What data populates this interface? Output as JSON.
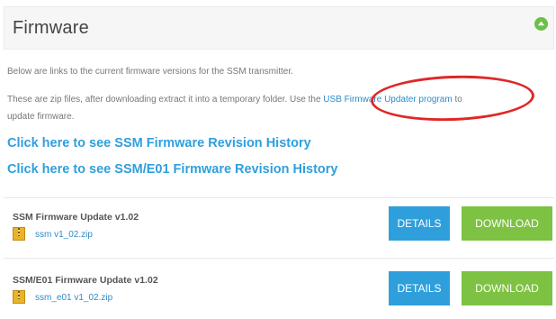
{
  "header": {
    "title": "Firmware",
    "toggle_icon": "collapse-icon"
  },
  "intro": {
    "line1": "Below are links to the current firmware versions for the SSM transmitter.",
    "line2_pre": "These are zip files, after downloading extract it into a temporary folder. Use the ",
    "updater_link": "USB Firmware Updater program",
    "line2_post": " to",
    "line3": "update firmware."
  },
  "history_links": [
    "Click here to see SSM Firmware Revision History",
    "Click here to see SSM/E01 Firmware Revision History"
  ],
  "firmware": [
    {
      "title": "SSM Firmware Update v1.02",
      "file": "ssm v1_02.zip",
      "details": "DETAILS",
      "download": "DOWNLOAD"
    },
    {
      "title": "SSM/E01 Firmware Update v1.02",
      "file": "ssm_e01 v1_02.zip",
      "details": "DETAILS",
      "download": "DOWNLOAD"
    }
  ],
  "colors": {
    "link": "#2f9fdc",
    "details_button": "#2f9fdc",
    "download_button": "#7dc242",
    "annotation": "#e02727"
  }
}
